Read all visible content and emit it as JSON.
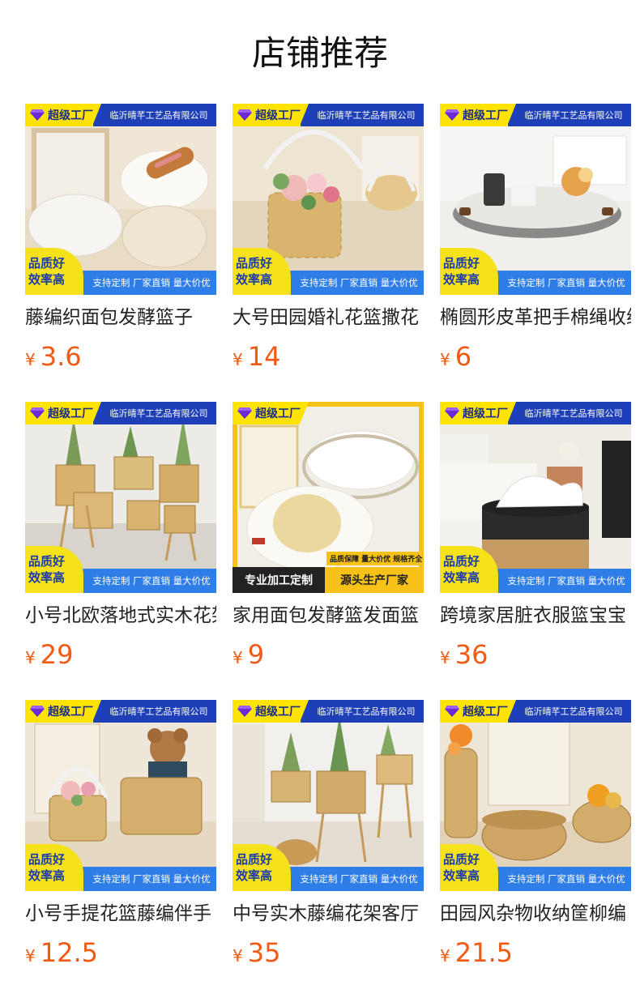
{
  "page": {
    "title": "店铺推荐"
  },
  "badge": {
    "factory_label": "超级工厂",
    "company": "临沂晴芊工艺品有限公司",
    "quality_line1": "品质好",
    "quality_line2": "效率高",
    "strip": "支持定制 厂家直销 量大价优"
  },
  "special_badge": {
    "factory_label": "超级工厂",
    "tags": "品质保障  量大价优  规格齐全",
    "left": "专业加工定制",
    "right": "源头生产厂家"
  },
  "currency": "¥",
  "products": [
    {
      "name": "藤编织面包发酵篮子",
      "price": "3.6"
    },
    {
      "name": "大号田园婚礼花篮撒花",
      "price": "14"
    },
    {
      "name": "椭圆形皮革把手棉绳收纳",
      "price": "6"
    },
    {
      "name": "小号北欧落地式实木花架",
      "price": "29"
    },
    {
      "name": "家用面包发酵篮发面篮",
      "price": "9"
    },
    {
      "name": "跨境家居脏衣服篮宝宝",
      "price": "36"
    },
    {
      "name": "小号手提花篮藤编伴手",
      "price": "12.5"
    },
    {
      "name": "中号实木藤编花架客厅",
      "price": "35"
    },
    {
      "name": "田园风杂物收纳筐柳编",
      "price": "21.5"
    }
  ]
}
